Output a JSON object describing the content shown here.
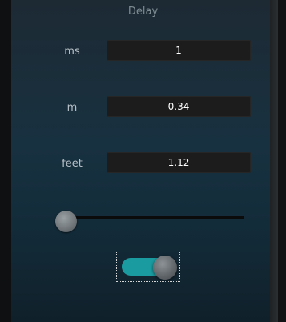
{
  "panel": {
    "title": "Delay"
  },
  "fields": {
    "ms": {
      "label": "ms",
      "value": "1"
    },
    "m": {
      "label": "m",
      "value": "0.34"
    },
    "feet": {
      "label": "feet",
      "value": "1.12"
    }
  },
  "slider": {
    "value_fraction": 0.0
  },
  "toggle": {
    "state": "on",
    "accent_color": "#1a9b9f"
  }
}
